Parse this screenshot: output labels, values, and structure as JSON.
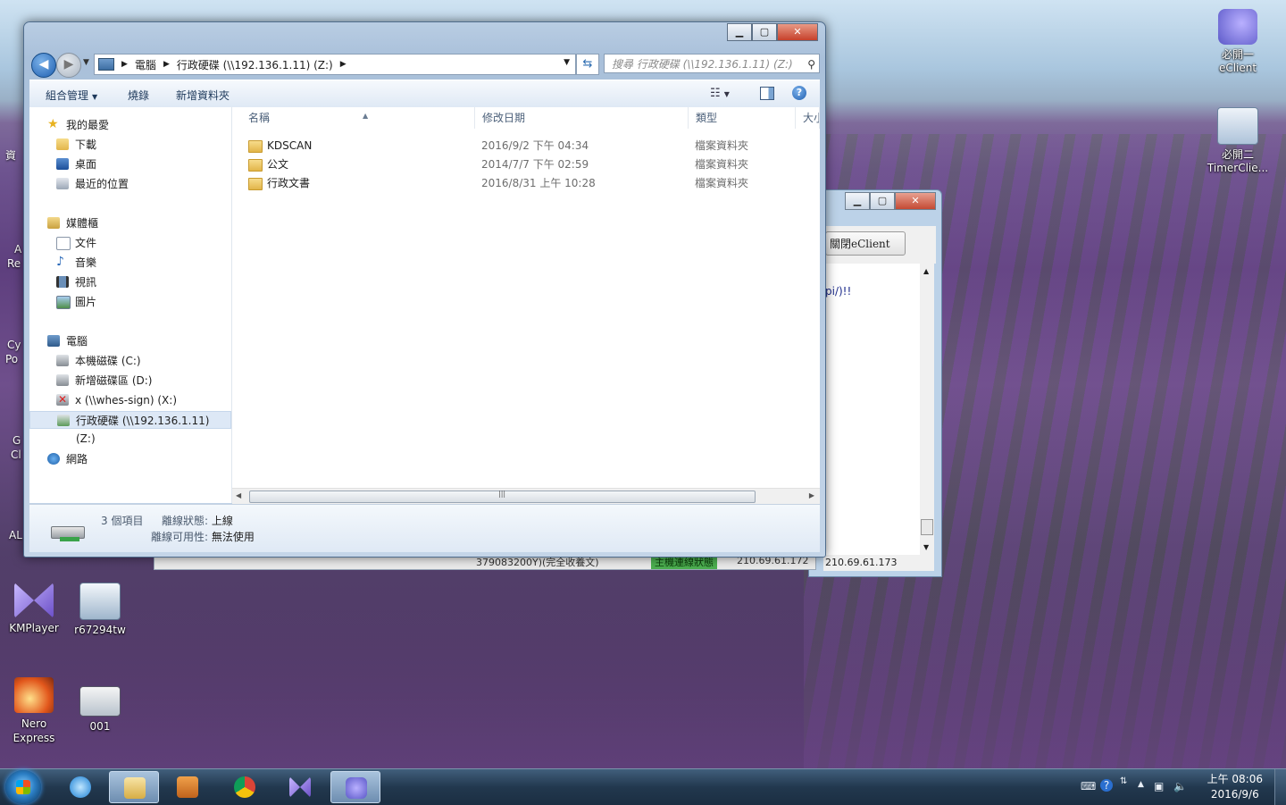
{
  "desktop": {
    "icons_right": [
      {
        "label": "必開一\neClient",
        "name": "eclient-shortcut"
      },
      {
        "label": "必開二\nTimerClie...",
        "name": "timerclient-shortcut"
      }
    ],
    "icons_left": [
      {
        "label": "KMPlayer",
        "name": "kmplayer-shortcut"
      },
      {
        "label": "r67294tw",
        "name": "r67294tw-shortcut"
      },
      {
        "label": "Nero\nExpress",
        "name": "nero-express-shortcut"
      },
      {
        "label": "001",
        "name": "shortcut-001"
      }
    ],
    "partial_labels": [
      "資",
      "A",
      "Re",
      "Cy",
      "Po",
      "G",
      "Cl",
      "AL"
    ]
  },
  "bg_window": {
    "button_label": "關閉eClient",
    "content_text": "pi/)!!",
    "status_ip": "210.69.61.173",
    "strip": {
      "left_text": "379083200Y)(完全收養文)",
      "status_label": "主機連線狀態",
      "ip1": "210.69.61.172"
    }
  },
  "explorer": {
    "address": {
      "crumbs": [
        "電腦",
        "行政硬碟 (\\\\192.136.1.11) (Z:)"
      ]
    },
    "search_placeholder": "搜尋 行政硬碟 (\\\\192.136.1.11) (Z:)",
    "commands": {
      "organize": "組合管理",
      "burn": "燒錄",
      "new_folder": "新增資料夾"
    },
    "nav": {
      "favorites": "我的最愛",
      "downloads": "下載",
      "desktop": "桌面",
      "recent": "最近的位置",
      "libraries": "媒體櫃",
      "documents": "文件",
      "music": "音樂",
      "videos": "視訊",
      "pictures": "圖片",
      "computer": "電腦",
      "drive_c": "本機磁碟 (C:)",
      "drive_d": "新增磁碟區 (D:)",
      "drive_x": "x (\\\\whes-sign) (X:)",
      "drive_z": "行政硬碟 (\\\\192.136.1.11) (Z:)",
      "network": "網路"
    },
    "columns": {
      "name": "名稱",
      "date": "修改日期",
      "type": "類型",
      "size": "大小"
    },
    "files": [
      {
        "name": "KDSCAN",
        "date": "2016/9/2 下午 04:34",
        "type": "檔案資料夾"
      },
      {
        "name": "公文",
        "date": "2014/7/7 下午 02:59",
        "type": "檔案資料夾"
      },
      {
        "name": "行政文書",
        "date": "2016/8/31 上午 10:28",
        "type": "檔案資料夾"
      }
    ],
    "details": {
      "count": "3 個項目",
      "offline_status_label": "離線狀態:",
      "offline_status_value": "上線",
      "offline_avail_label": "離線可用性:",
      "offline_avail_value": "無法使用"
    }
  },
  "taskbar": {
    "clock_time": "上午 08:06",
    "clock_date": "2016/9/6"
  },
  "colors": {
    "accent": "#1f5fb0",
    "taskbar": "#22384e",
    "selection": "#dde8f6"
  }
}
